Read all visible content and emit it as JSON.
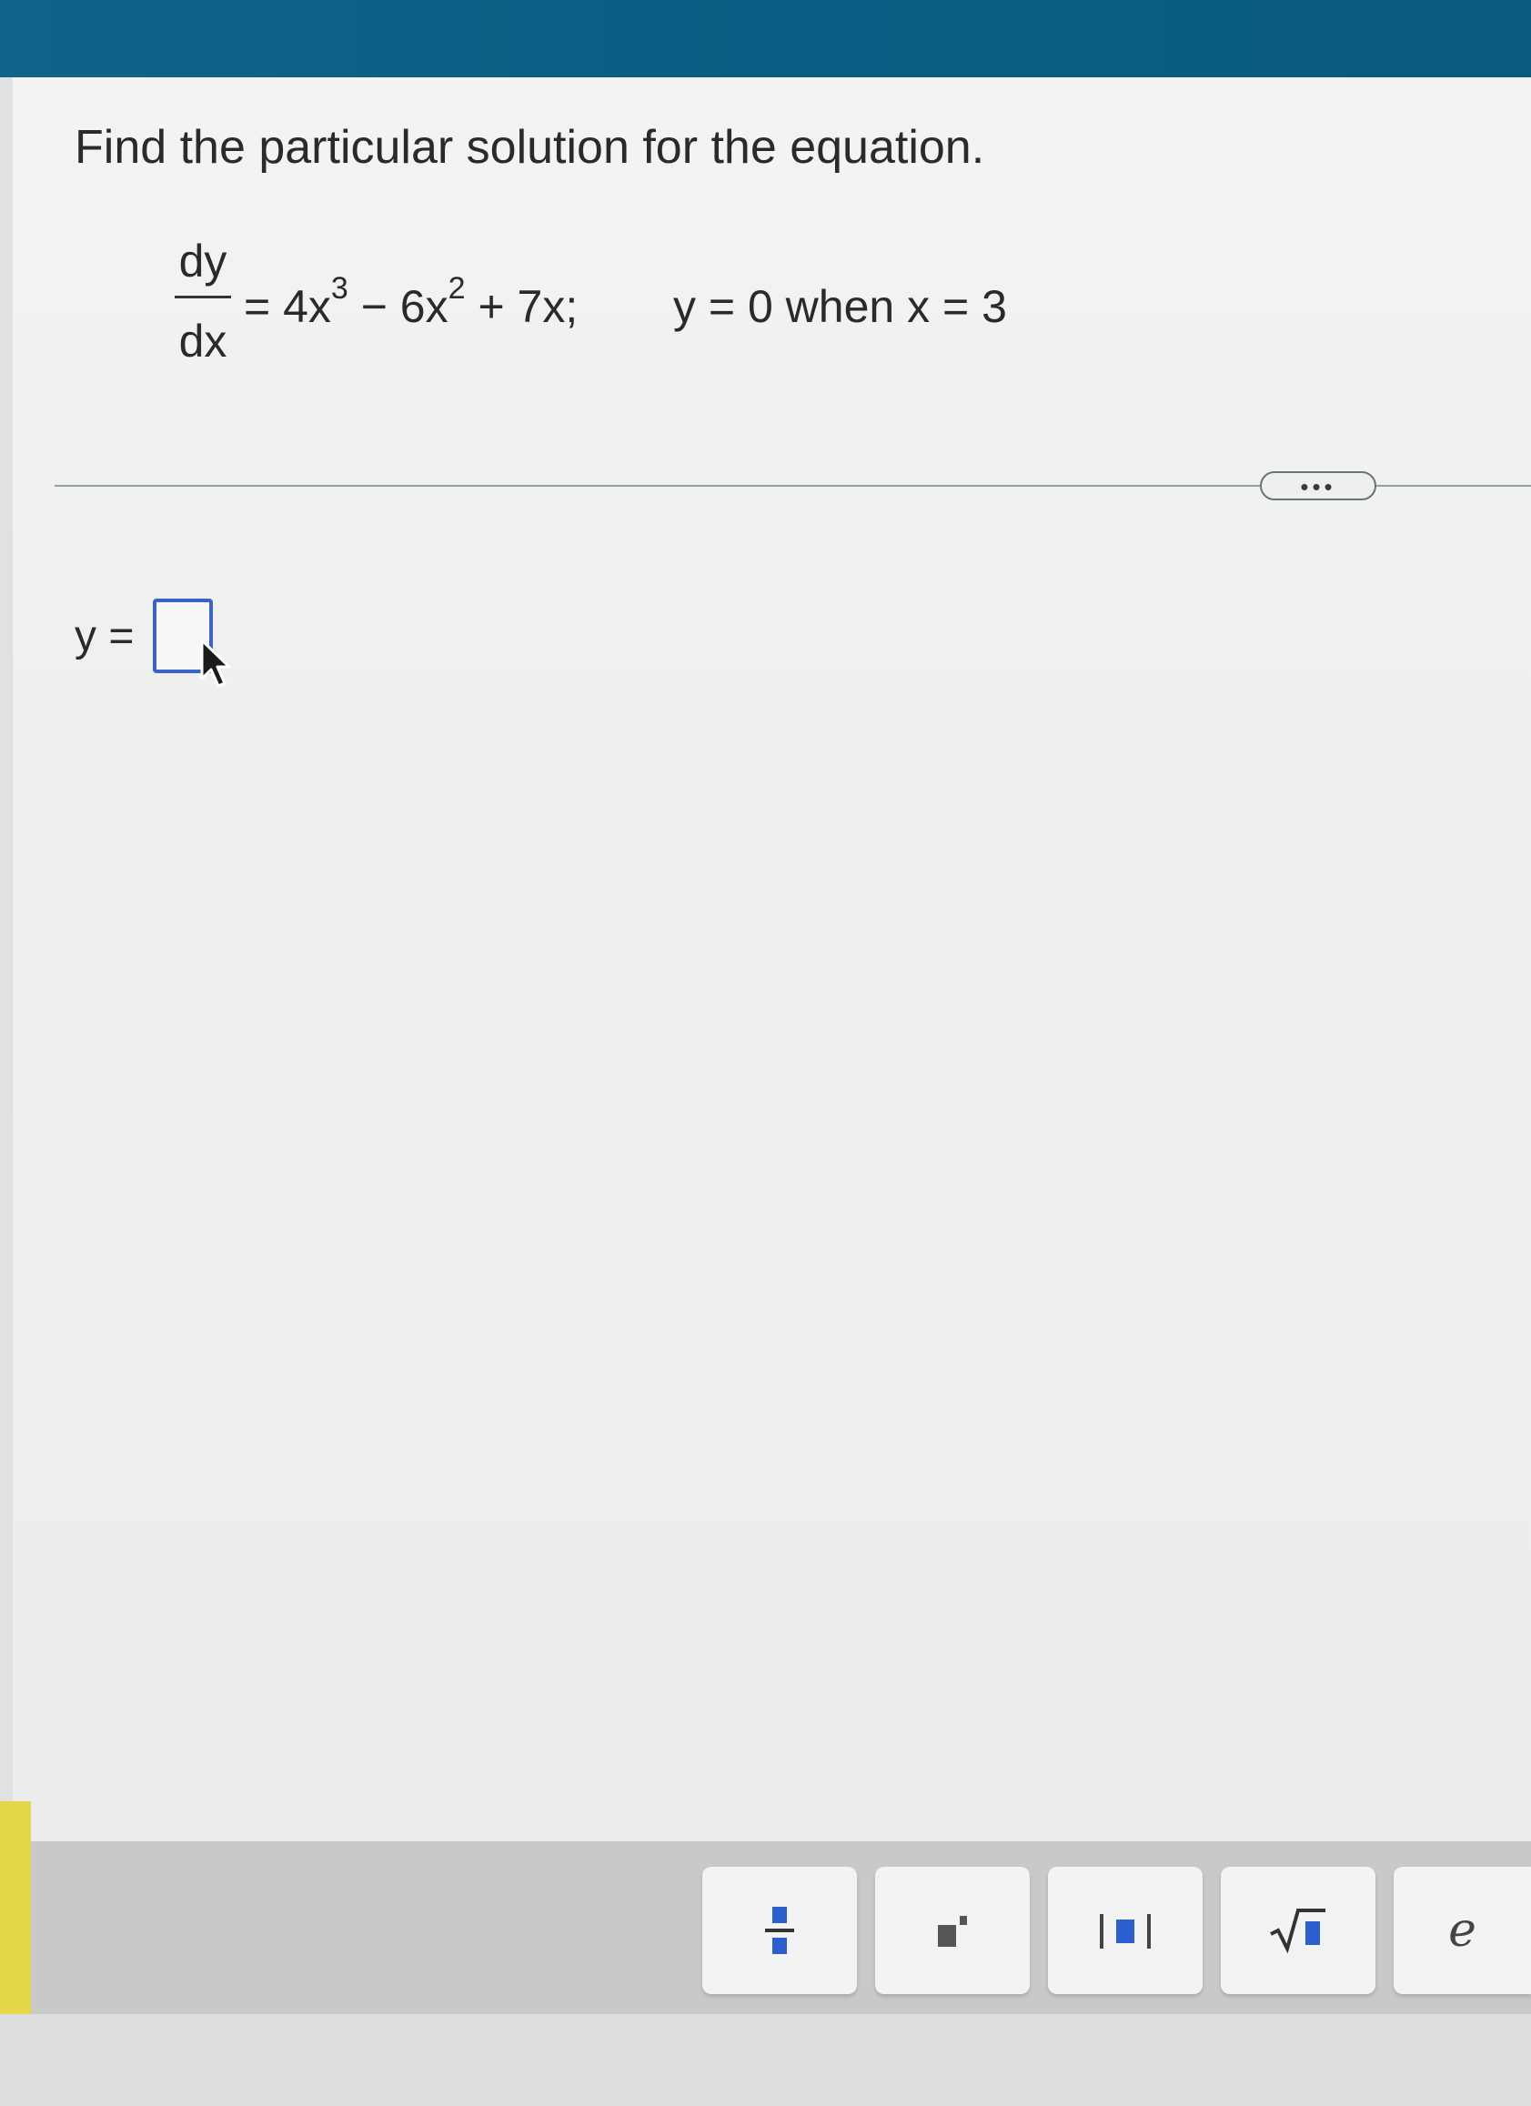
{
  "question": {
    "prompt": "Find the particular solution for the equation."
  },
  "equation": {
    "numerator": "dy",
    "denominator": "dx",
    "rhs_a": "= 4x",
    "exp_a": "3",
    "rhs_b": " − 6x",
    "exp_b": "2",
    "rhs_c": " + 7x;",
    "condition": "y = 0 when x = 3"
  },
  "more_button": {
    "label": "•••"
  },
  "answer": {
    "label": "y =",
    "value": ""
  },
  "toolbar": {
    "buttons": [
      {
        "icon": "fraction-icon"
      },
      {
        "icon": "exponent-icon"
      },
      {
        "icon": "absolute-value-icon"
      },
      {
        "icon": "square-root-icon"
      },
      {
        "icon": "euler-e-icon",
        "label": "e"
      }
    ]
  },
  "colors": {
    "top_bar": "#0a5d82",
    "input_border": "#3a64c8",
    "tool_icon_blue": "#2b5fd0"
  }
}
